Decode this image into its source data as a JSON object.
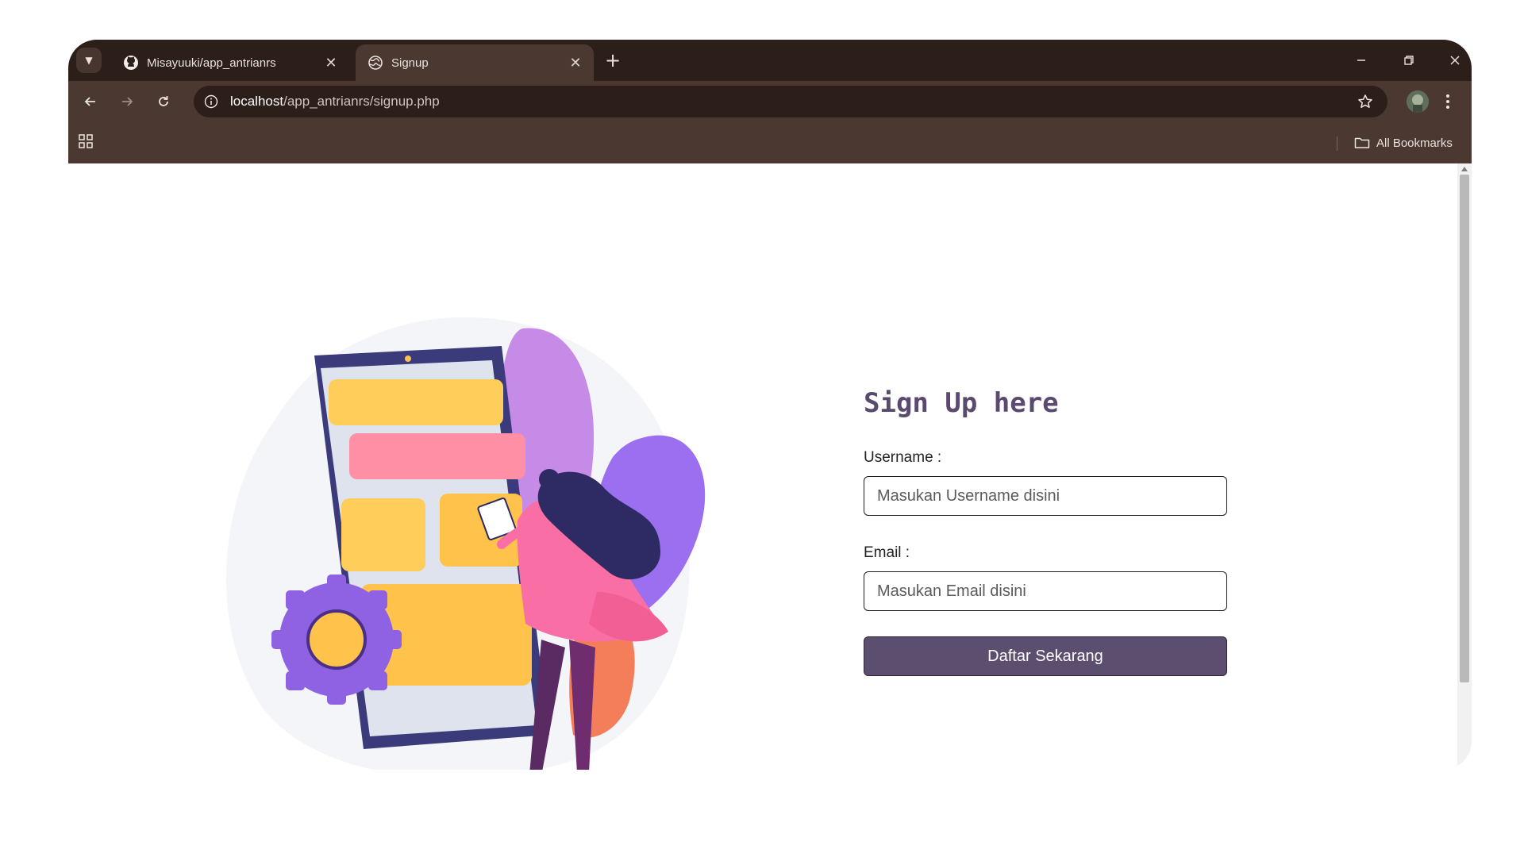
{
  "browser": {
    "tabs": [
      {
        "title": "Misayuuki/app_antrianrs",
        "icon": "github-icon",
        "active": false
      },
      {
        "title": "Signup",
        "icon": "globe-icon",
        "active": true
      }
    ],
    "url_host": "localhost",
    "url_path": "/app_antrianrs/signup.php",
    "bookmarks_label": "All Bookmarks"
  },
  "page": {
    "heading": "Sign Up here",
    "username_label": "Username :",
    "username_placeholder": "Masukan Username disini",
    "email_label": "Email :",
    "email_placeholder": "Masukan Email disini",
    "submit_label": "Daftar Sekarang",
    "illustration": "signup-illustration"
  },
  "colors": {
    "titlebar": "#2c1e19",
    "toolbar": "#4a3831",
    "heading": "#5b4a6f",
    "button": "#5c4e6e"
  }
}
